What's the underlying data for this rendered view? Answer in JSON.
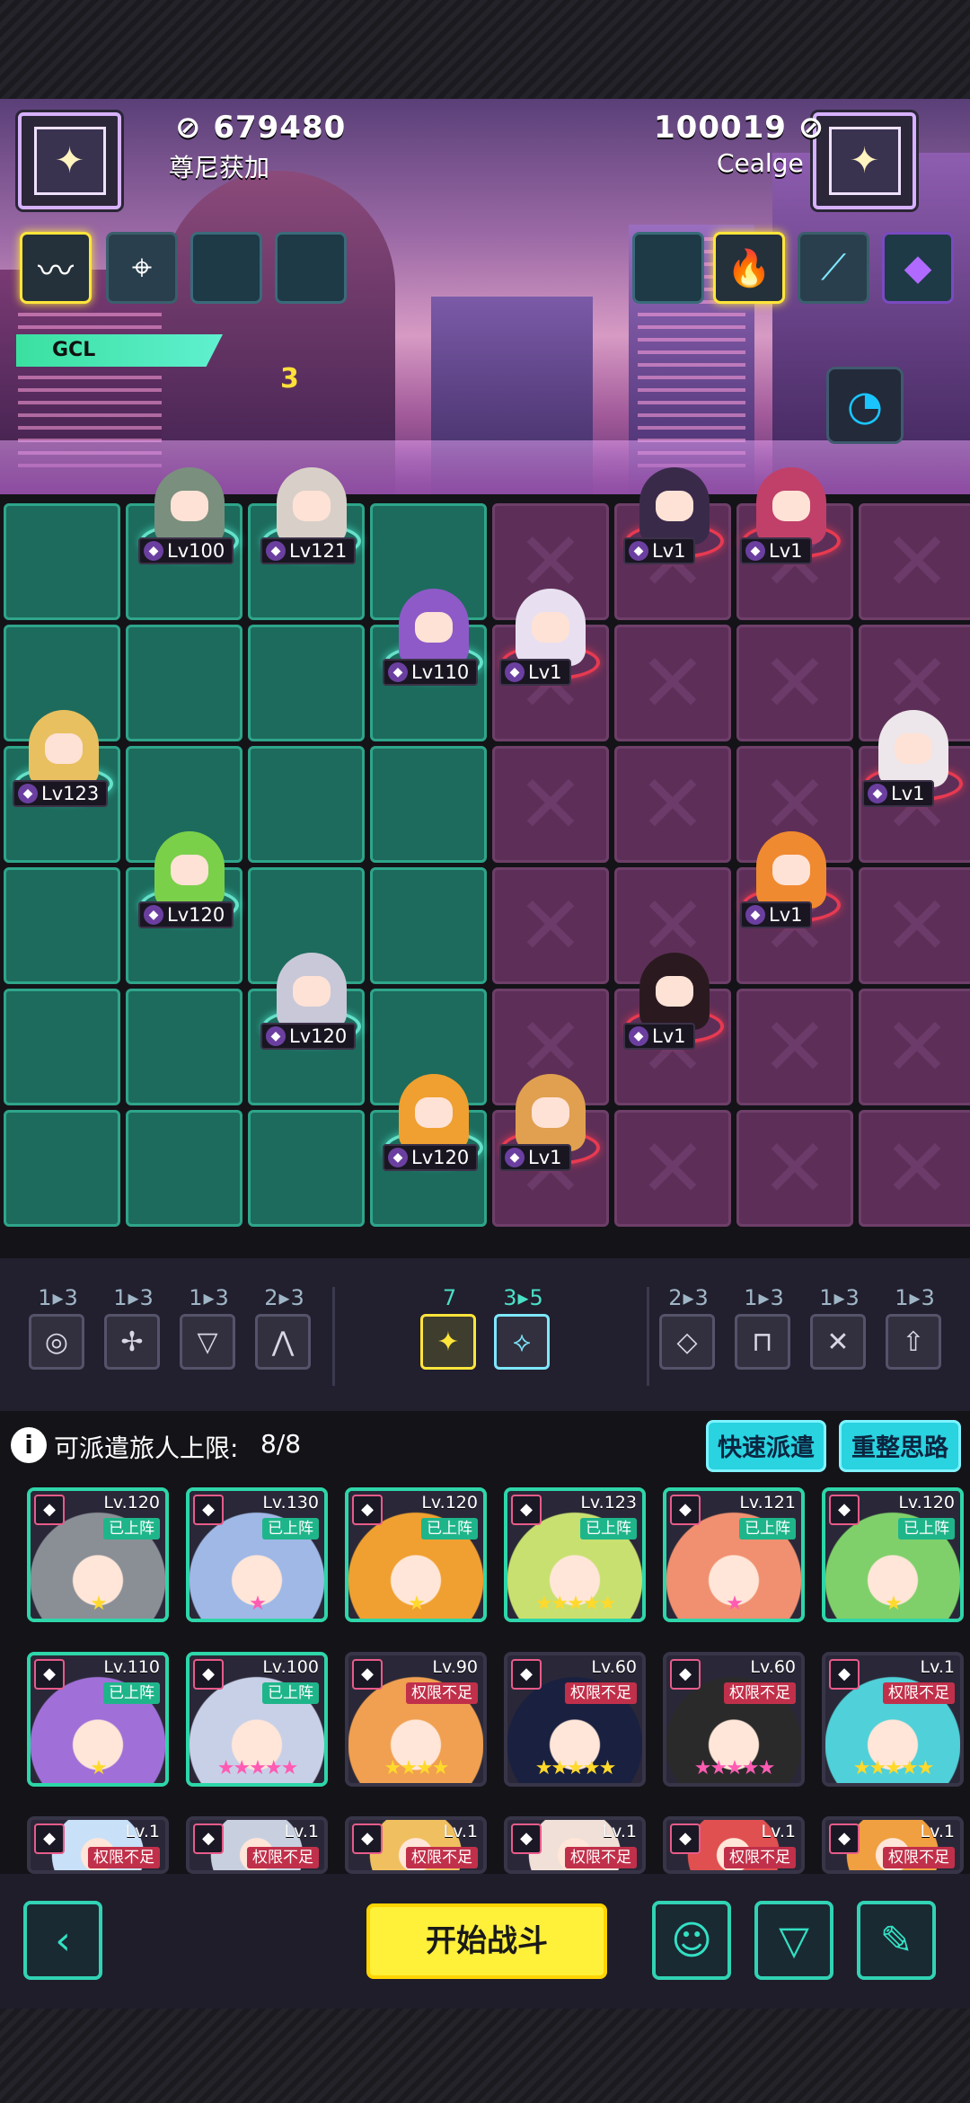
{
  "players": {
    "left": {
      "score": "679480",
      "name": "尊尼获加"
    },
    "right": {
      "score": "100019",
      "name": "Cealge"
    }
  },
  "scene": {
    "label_left": "GCL",
    "label_3": "3"
  },
  "left_buffs": [
    "wave-icon",
    "crosshair-icon",
    "empty",
    "empty"
  ],
  "right_buffs": [
    "empty",
    "fire-icon",
    "slash-icon",
    "crystal-icon"
  ],
  "ally_units": [
    {
      "level": "Lv100"
    },
    {
      "level": "Lv121"
    },
    {
      "level": "Lv110"
    },
    {
      "level": "Lv123"
    },
    {
      "level": "Lv120"
    },
    {
      "level": "Lv120"
    },
    {
      "level": "Lv120"
    }
  ],
  "enemy_units": [
    {
      "level": "Lv1"
    },
    {
      "level": "Lv1"
    },
    {
      "level": "Lv1"
    },
    {
      "level": "Lv1"
    },
    {
      "level": "Lv1"
    },
    {
      "level": "Lv1"
    },
    {
      "level": "Lv1"
    }
  ],
  "traits": {
    "left": [
      {
        "count": "1▸3",
        "icon": "swirl-icon"
      },
      {
        "count": "1▸3",
        "icon": "shuriken-icon"
      },
      {
        "count": "1▸3",
        "icon": "triangle-icon"
      },
      {
        "count": "2▸3",
        "icon": "mountain-icon"
      }
    ],
    "center": [
      {
        "count": "7",
        "icon": "star-icon"
      },
      {
        "count": "3▸5",
        "icon": "bow-icon"
      }
    ],
    "right": [
      {
        "count": "2▸3",
        "icon": "diamond-icon"
      },
      {
        "count": "1▸3",
        "icon": "gate-icon"
      },
      {
        "count": "1▸3",
        "icon": "crossed-swords-icon"
      },
      {
        "count": "1▸3",
        "icon": "arrow-up-icon"
      }
    ]
  },
  "roster": {
    "label": "可派遣旅人上限:",
    "count": "8/8",
    "quick_dispatch": "快速派遣",
    "rethink": "重整思路",
    "tag_deployed": "已上阵",
    "tag_locked": "权限不足",
    "cards": [
      {
        "level": "Lv.120",
        "tag": "已上阵",
        "stars": "★"
      },
      {
        "level": "Lv.130",
        "tag": "已上阵",
        "stars": "★"
      },
      {
        "level": "Lv.120",
        "tag": "已上阵",
        "stars": "★"
      },
      {
        "level": "Lv.123",
        "tag": "已上阵",
        "stars": "★★★★★"
      },
      {
        "level": "Lv.121",
        "tag": "已上阵",
        "stars": "★"
      },
      {
        "level": "Lv.120",
        "tag": "已上阵",
        "stars": "★"
      },
      {
        "level": "Lv.110",
        "tag": "已上阵",
        "stars": "★"
      },
      {
        "level": "Lv.100",
        "tag": "已上阵",
        "stars": "★★★★★"
      },
      {
        "level": "Lv.90",
        "tag": "权限不足",
        "stars": "★★★★"
      },
      {
        "level": "Lv.60",
        "tag": "权限不足",
        "stars": "★★★★★"
      },
      {
        "level": "Lv.60",
        "tag": "权限不足",
        "stars": "★★★★★"
      },
      {
        "level": "Lv.1",
        "tag": "权限不足",
        "stars": "★★★★★"
      },
      {
        "level": "Lv.1",
        "tag": "权限不足",
        "stars": ""
      },
      {
        "level": "Lv.1",
        "tag": "权限不足",
        "stars": ""
      },
      {
        "level": "Lv.1",
        "tag": "权限不足",
        "stars": ""
      },
      {
        "level": "Lv.1",
        "tag": "权限不足",
        "stars": ""
      },
      {
        "level": "Lv.1",
        "tag": "权限不足",
        "stars": ""
      },
      {
        "level": "Lv.1",
        "tag": "权限不足",
        "stars": ""
      }
    ]
  },
  "bottom": {
    "start_battle": "开始战斗"
  }
}
